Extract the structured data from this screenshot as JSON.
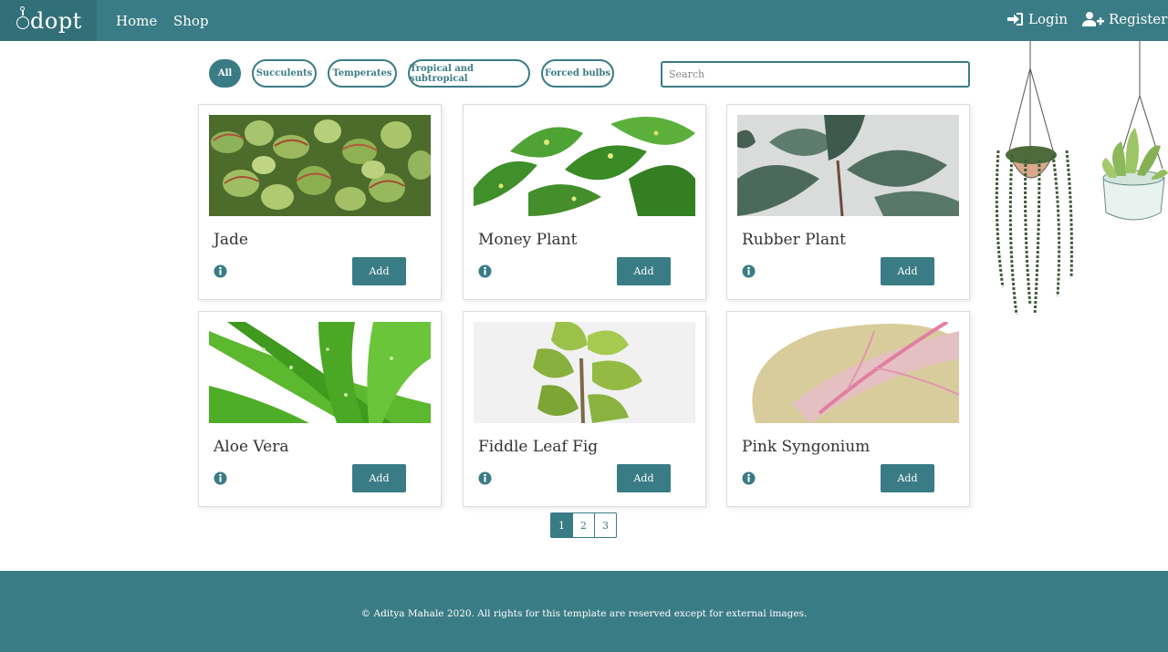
{
  "nav": {
    "brand": "dopt",
    "links": [
      "Home",
      "Shop"
    ],
    "login": "Login",
    "register": "Register"
  },
  "filters": {
    "items": [
      "All",
      "Succulents",
      "Temperates",
      "Tropical and subtropical",
      "Forced bulbs"
    ],
    "active": "All"
  },
  "search": {
    "placeholder": "Search",
    "value": ""
  },
  "products": [
    {
      "name": "Jade",
      "add_label": "Add",
      "info_icon": "info-circle-icon"
    },
    {
      "name": "Money Plant",
      "add_label": "Add",
      "info_icon": "info-circle-icon"
    },
    {
      "name": "Rubber Plant",
      "add_label": "Add",
      "info_icon": "info-circle-icon"
    },
    {
      "name": "Aloe Vera",
      "add_label": "Add",
      "info_icon": "info-circle-icon"
    },
    {
      "name": "Fiddle Leaf Fig",
      "add_label": "Add",
      "info_icon": "info-circle-icon"
    },
    {
      "name": "Pink Syngonium",
      "add_label": "Add",
      "info_icon": "info-circle-icon"
    }
  ],
  "pagination": {
    "pages": [
      "1",
      "2",
      "3"
    ],
    "current": "1"
  },
  "footer": {
    "text": "© Aditya Mahale 2020. All rights for this template are reserved except for external images."
  },
  "colors": {
    "accent": "#3a7c85",
    "brand_bg": "#327078"
  }
}
